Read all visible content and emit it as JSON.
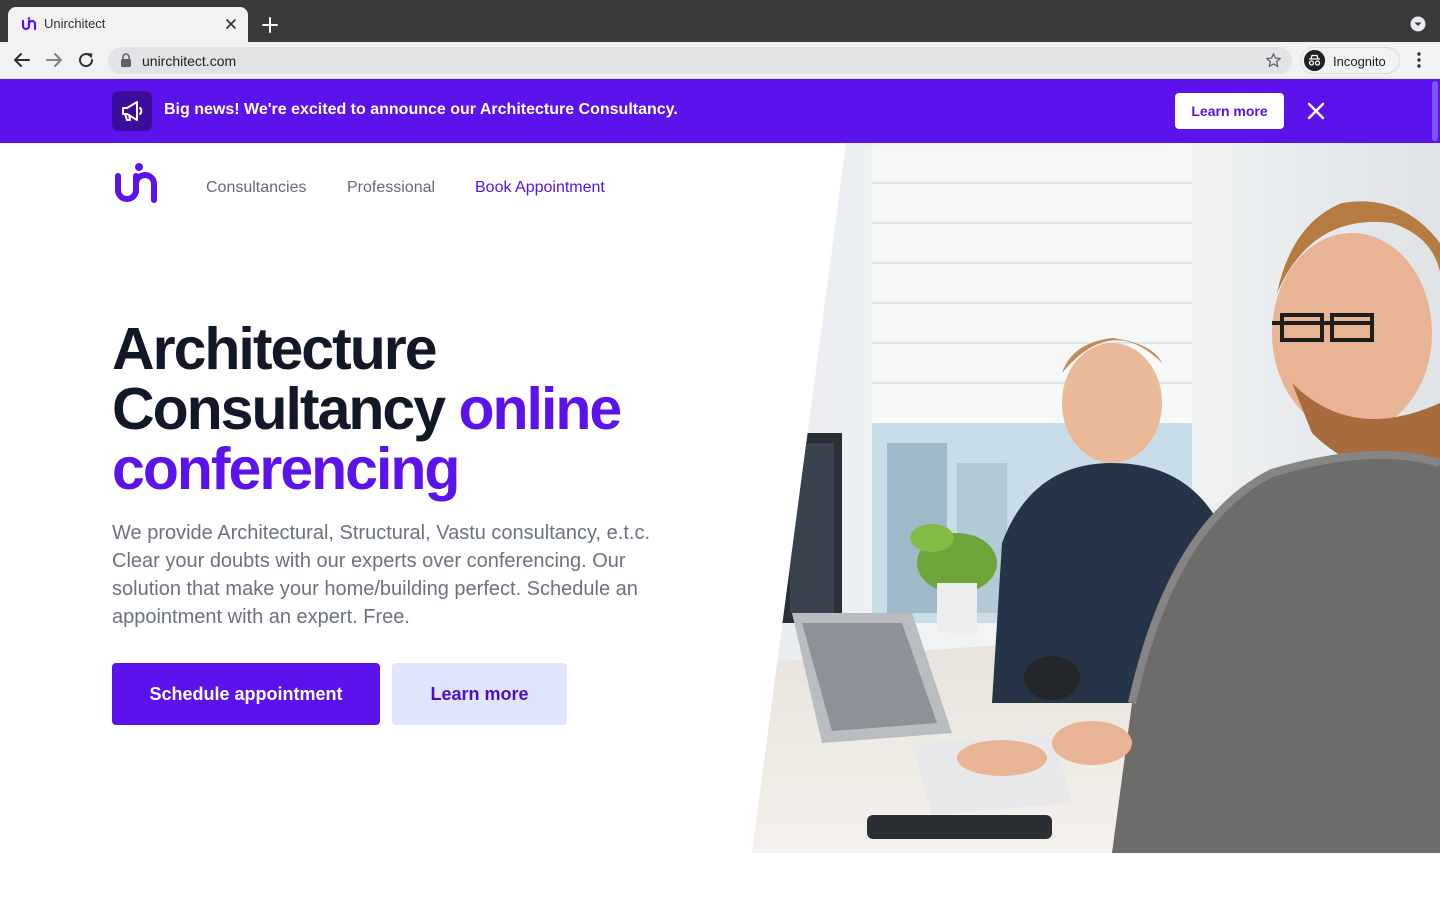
{
  "browser": {
    "tab_title": "Unirchitect",
    "url": "unirchitect.com",
    "profile_label": "Incognito"
  },
  "banner": {
    "message": "Big news! We're excited to announce our Architecture Consultancy.",
    "cta_label": "Learn more"
  },
  "header": {
    "nav": [
      {
        "label": "Consultancies"
      },
      {
        "label": "Professional"
      },
      {
        "label": "Book Appointment"
      }
    ]
  },
  "hero": {
    "title_line1": "Architecture",
    "title_line2": "Consultancy",
    "title_accent1": "online",
    "title_accent2": "conferencing",
    "description": "We provide Architectural, Structural, Vastu consultancy, e.t.c. Clear your doubts with our experts over conferencing. Our solution that make your home/building perfect. Schedule an appointment with an expert. Free.",
    "primary_cta": "Schedule appointment",
    "secondary_cta": "Learn more"
  },
  "colors": {
    "brand": "#5b12eb",
    "heading": "#111827",
    "body_text": "#6b7280",
    "secondary_button_bg": "#e1e4fd"
  },
  "icons": {
    "favicon": "unirchitect-logo-icon",
    "banner": "megaphone-icon",
    "close": "close-icon",
    "nav_back": "back-arrow-icon",
    "nav_forward": "forward-arrow-icon",
    "reload": "reload-icon",
    "lock": "lock-icon",
    "bookmark": "star-icon",
    "incognito": "incognito-icon",
    "menu": "kebab-menu-icon"
  }
}
